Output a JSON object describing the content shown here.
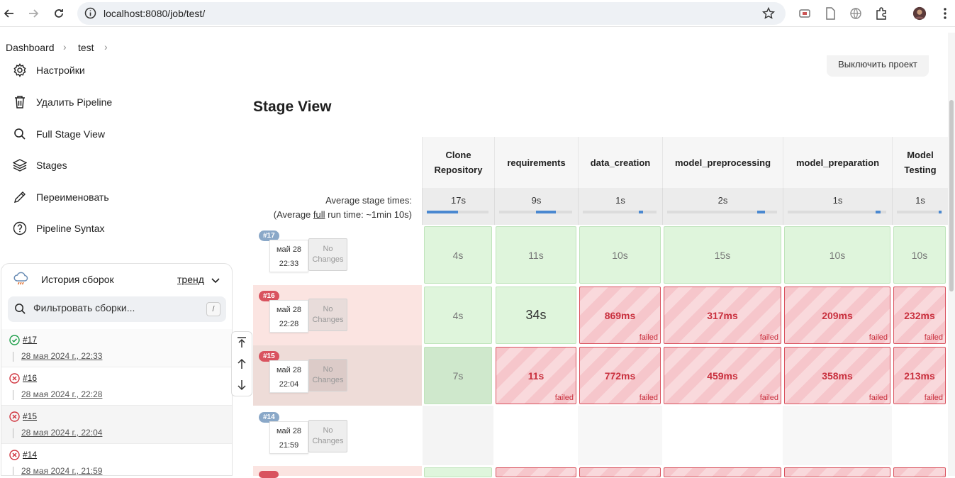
{
  "browser": {
    "url": "localhost:8080/job/test/"
  },
  "breadcrumb": {
    "items": [
      "Dashboard",
      "test"
    ]
  },
  "sidebar": {
    "items": [
      {
        "label": "Настройки",
        "icon": "gear-icon"
      },
      {
        "label": "Удалить Pipeline",
        "icon": "trash-icon"
      },
      {
        "label": "Full Stage View",
        "icon": "search-icon"
      },
      {
        "label": "Stages",
        "icon": "layers-icon"
      },
      {
        "label": "Переименовать",
        "icon": "pencil-icon"
      },
      {
        "label": "Pipeline Syntax",
        "icon": "help-icon"
      }
    ]
  },
  "history": {
    "title": "История сборок",
    "trend_label": "тренд",
    "search_placeholder": "Фильтровать сборки...",
    "shortcut": "/",
    "builds": [
      {
        "number": "#17",
        "date": "28 мая 2024 г., 22:33",
        "status": "success"
      },
      {
        "number": "#16",
        "date": "28 мая 2024 г., 22:28",
        "status": "failed"
      },
      {
        "number": "#15",
        "date": "28 мая 2024 г., 22:04",
        "status": "failed"
      },
      {
        "number": "#14",
        "date": "28 мая 2024 г., 21:59",
        "status": "failed"
      }
    ]
  },
  "main": {
    "disable_button": "Выключить проект",
    "title": "Stage View",
    "avg_label_1": "Average stage times:",
    "avg_label_2_pre": "(Average ",
    "avg_label_2_link": "full",
    "avg_label_2_post": " run time: ~1min 10s)",
    "stages": [
      {
        "name": "Clone Repository",
        "avg": "17s",
        "bar": 0.5
      },
      {
        "name": "requirements",
        "avg": "9s",
        "bar": 0.3
      },
      {
        "name": "data_creation",
        "avg": "1s",
        "bar": 0.06
      },
      {
        "name": "model_preprocessing",
        "avg": "2s",
        "bar": 0.08
      },
      {
        "name": "model_preparation",
        "avg": "1s",
        "bar": 0.06
      },
      {
        "name": "Model Testing",
        "avg": "1s",
        "bar": 0.06
      }
    ],
    "runs": [
      {
        "badge": "#17",
        "date": "май 28",
        "time": "22:33",
        "changes": "No Changes",
        "cells": [
          {
            "v": "4s",
            "s": "ok"
          },
          {
            "v": "11s",
            "s": "ok"
          },
          {
            "v": "10s",
            "s": "ok"
          },
          {
            "v": "15s",
            "s": "ok"
          },
          {
            "v": "10s",
            "s": "ok"
          },
          {
            "v": "10s",
            "s": "ok"
          }
        ]
      },
      {
        "badge": "#16",
        "date": "май 28",
        "time": "22:28",
        "changes": "No Changes",
        "cells": [
          {
            "v": "4s",
            "s": "ok"
          },
          {
            "v": "34s",
            "s": "ok"
          },
          {
            "v": "869ms",
            "s": "fail"
          },
          {
            "v": "317ms",
            "s": "fail"
          },
          {
            "v": "209ms",
            "s": "fail"
          },
          {
            "v": "232ms",
            "s": "fail"
          }
        ]
      },
      {
        "badge": "#15",
        "date": "май 28",
        "time": "22:04",
        "changes": "No Changes",
        "cells": [
          {
            "v": "7s",
            "s": "ok"
          },
          {
            "v": "11s",
            "s": "fail"
          },
          {
            "v": "772ms",
            "s": "fail"
          },
          {
            "v": "459ms",
            "s": "fail"
          },
          {
            "v": "358ms",
            "s": "fail"
          },
          {
            "v": "213ms",
            "s": "fail"
          }
        ]
      },
      {
        "badge": "#14",
        "date": "май 28",
        "time": "21:59",
        "changes": "No Changes",
        "cells": [
          {
            "v": "",
            "s": "empty"
          },
          {
            "v": "",
            "s": "empty"
          },
          {
            "v": "",
            "s": "empty"
          },
          {
            "v": "",
            "s": "empty"
          },
          {
            "v": "",
            "s": "empty"
          },
          {
            "v": "",
            "s": "empty"
          }
        ]
      }
    ],
    "failed_label": "failed"
  },
  "colors": {
    "success_green": "#dff5dc",
    "failed_red": "#d9535f",
    "badge_blue": "#8aa8c8",
    "badge_red": "#d9535f"
  }
}
